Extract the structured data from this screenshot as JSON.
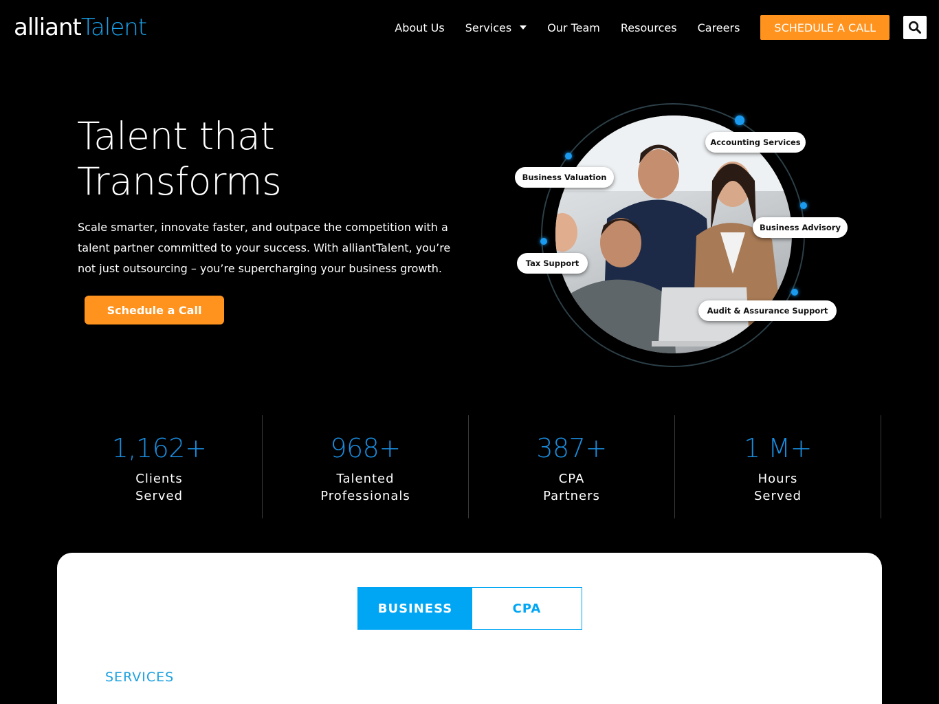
{
  "brand": {
    "name_part1": "alliant",
    "name_part2": "Talent",
    "accent": "#1aa6f0",
    "orange": "#ff931e"
  },
  "nav": {
    "items": [
      {
        "label": "About Us"
      },
      {
        "label": "Services"
      },
      {
        "label": "Our Team"
      },
      {
        "label": "Resources"
      },
      {
        "label": "Careers"
      }
    ],
    "cta_label": "SCHEDULE A CALL",
    "search_icon": "search-icon"
  },
  "hero": {
    "title_line1": "Talent that",
    "title_line2": "Transforms",
    "description": "Scale smarter, innovate faster, and outpace the competition with a talent partner committed to your success. With alliantTalent, you’re not just outsourcing – you’re supercharging your business growth.",
    "cta_label": "Schedule a Call"
  },
  "services_ring": {
    "labels": [
      "Accounting Services",
      "Business Valuation",
      "Business Advisory",
      "Tax Support",
      "Audit & Assurance Support"
    ]
  },
  "stats": [
    {
      "value": "1,162+",
      "line1": "Clients",
      "line2": "Served"
    },
    {
      "value": "968+",
      "line1": "Talented",
      "line2": "Professionals"
    },
    {
      "value": "387+",
      "line1": "CPA",
      "line2": "Partners"
    },
    {
      "value": "1 M+",
      "line1": "Hours",
      "line2": "Served"
    }
  ],
  "card": {
    "tabs": [
      {
        "label": "BUSINESS"
      },
      {
        "label": "CPA"
      }
    ],
    "section_label": "SERVICES"
  }
}
